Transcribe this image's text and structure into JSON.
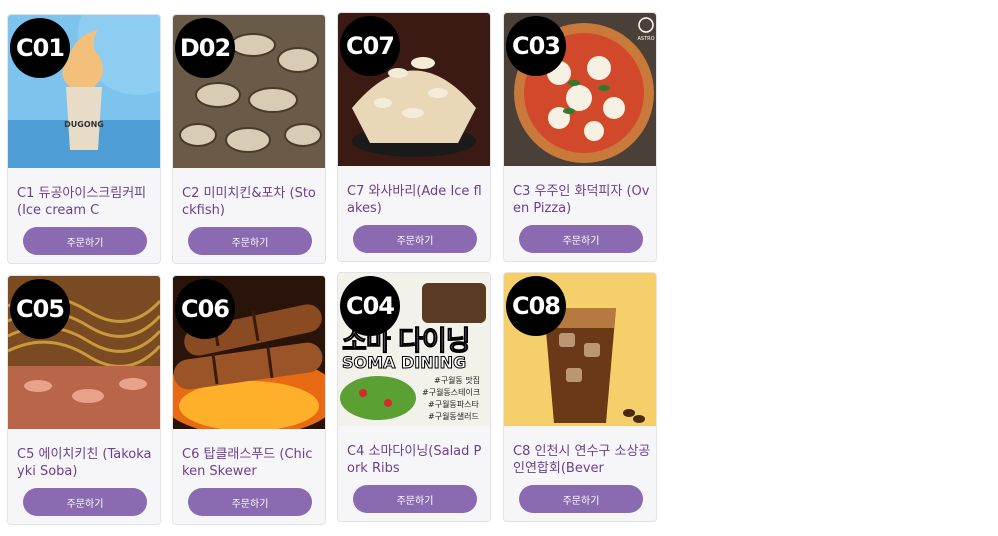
{
  "order_label": "주문하기",
  "products": [
    {
      "code": "C01",
      "name": "C1 듀공아이스크림커피(Ice cream C"
    },
    {
      "code": "D02",
      "name": "C2 미미치킨&포차 (Stockfish)"
    },
    {
      "code": "C07",
      "name": "C7 와사바리(Ade Ice flakes)"
    },
    {
      "code": "C03",
      "name": "C3 우주인 화덕피자 (Oven Pizza)"
    },
    {
      "code": "C05",
      "name": "C5 에이치키친 (Takokayki Soba)"
    },
    {
      "code": "C06",
      "name": "C6 탑클래스푸드 (Chicken Skewer"
    },
    {
      "code": "C04",
      "name": "C4 소마다이닝(Salad Pork Ribs"
    },
    {
      "code": "C08",
      "name": "C8 인천시 연수구 소상공인연합회(Bever"
    }
  ],
  "overlays": {
    "cup_brand": "DUGONG",
    "pizza_brand": "ASTRO",
    "soma_title": "소마 다이닝",
    "soma_subtitle": "SOMA DINING",
    "soma_tags": [
      "#구월동 맛집",
      "#구월동스테이크",
      "#구월동파스타",
      "#구월동샐러드"
    ]
  },
  "colors": {
    "accent": "#8a6bb1",
    "name_text": "#6b3f8e",
    "card_bg": "#f6f6f8"
  }
}
